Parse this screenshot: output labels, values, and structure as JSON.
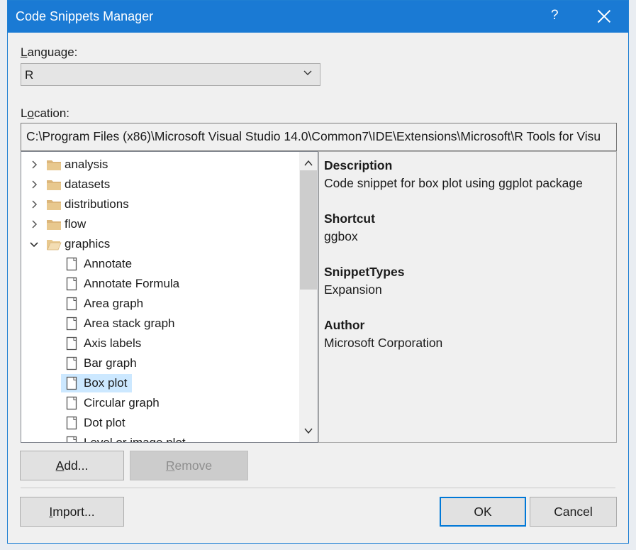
{
  "window": {
    "title": "Code Snippets Manager",
    "help": "?"
  },
  "language": {
    "label_accel": "L",
    "label_rest": "anguage:",
    "value": "R"
  },
  "location": {
    "label_pre": "L",
    "label_accel": "o",
    "label_rest": "cation:",
    "value": "C:\\Program Files (x86)\\Microsoft Visual Studio 14.0\\Common7\\IDE\\Extensions\\Microsoft\\R Tools for Visu"
  },
  "tree": {
    "folders": [
      {
        "label": "analysis",
        "expanded": false
      },
      {
        "label": "datasets",
        "expanded": false
      },
      {
        "label": "distributions",
        "expanded": false
      },
      {
        "label": "flow",
        "expanded": false
      },
      {
        "label": "graphics",
        "expanded": true
      }
    ],
    "snippets": [
      {
        "label": "Annotate"
      },
      {
        "label": "Annotate Formula"
      },
      {
        "label": "Area graph"
      },
      {
        "label": "Area stack graph"
      },
      {
        "label": "Axis labels"
      },
      {
        "label": "Bar graph"
      },
      {
        "label": "Box plot",
        "selected": true
      },
      {
        "label": "Circular graph"
      },
      {
        "label": "Dot plot"
      },
      {
        "label": "Level or image plot"
      }
    ]
  },
  "details": {
    "description_label": "Description",
    "description": "Code snippet for box plot using ggplot package",
    "shortcut_label": "Shortcut",
    "shortcut": "ggbox",
    "types_label": "SnippetTypes",
    "types": "Expansion",
    "author_label": "Author",
    "author": "Microsoft Corporation"
  },
  "buttons": {
    "add_accel": "A",
    "add_rest": "dd...",
    "remove_accel": "R",
    "remove_rest": "emove",
    "import_accel": "I",
    "import_rest": "mport...",
    "ok": "OK",
    "cancel": "Cancel"
  },
  "colors": {
    "titlebar": "#1a7ad4",
    "selection": "#cce8ff",
    "folder": "#dcb67a",
    "default_button_border": "#0078d7"
  }
}
